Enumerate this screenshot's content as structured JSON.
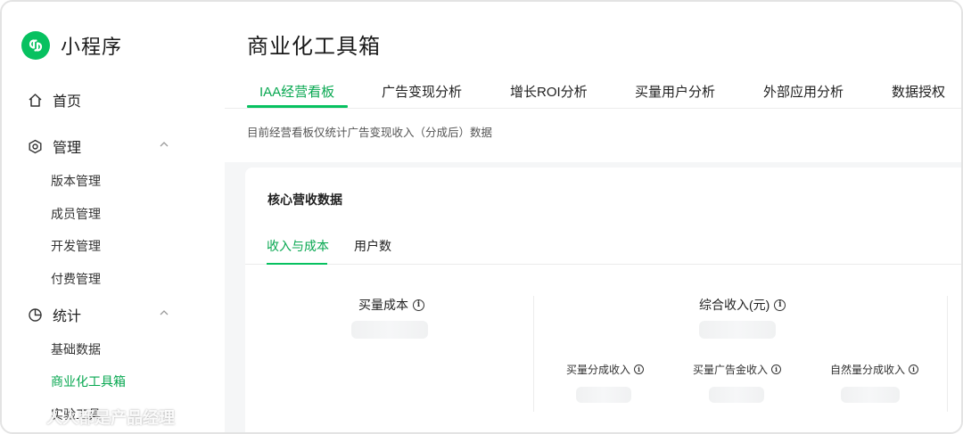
{
  "app": {
    "name": "小程序",
    "brand_color": "#07c160",
    "accent_color": "#07a750"
  },
  "sidebar": {
    "items": [
      {
        "label": "首页",
        "icon": "home-icon"
      },
      {
        "label": "管理",
        "icon": "hexagon-settings-icon",
        "expanded": true,
        "children": [
          "版本管理",
          "成员管理",
          "开发管理",
          "付费管理"
        ]
      },
      {
        "label": "统计",
        "icon": "pie-chart-icon",
        "expanded": true,
        "children": [
          "基础数据",
          "商业化工具箱",
          "实验工具"
        ]
      }
    ],
    "active_item": "商业化工具箱"
  },
  "page": {
    "title": "商业化工具箱",
    "tabs": [
      "IAA经营看板",
      "广告变现分析",
      "增长ROI分析",
      "买量用户分析",
      "外部应用分析",
      "数据授权"
    ],
    "active_tab": "IAA经营看板",
    "notice": "目前经营看板仅统计广告变现收入（分成后）数据"
  },
  "card": {
    "title": "核心营收数据",
    "subtabs": [
      "收入与成本",
      "用户数"
    ],
    "active_subtab": "收入与成本",
    "metrics": {
      "cost_label": "买量成本",
      "revenue_label": "综合收入(元)",
      "sub": [
        "买量分成收入",
        "买量广告金收入",
        "自然量分成收入"
      ]
    }
  },
  "watermark": {
    "text": "人人都是产品经理"
  }
}
